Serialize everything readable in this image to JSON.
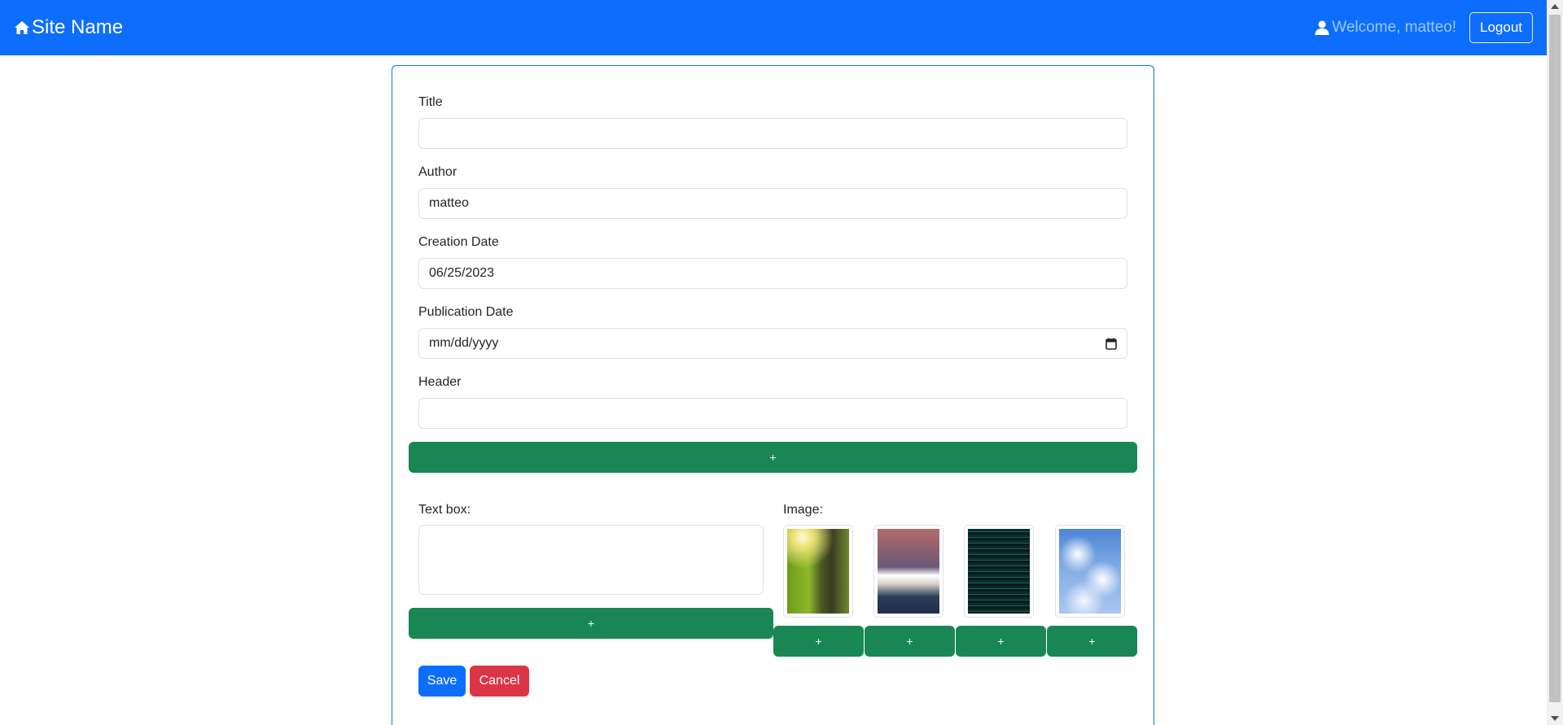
{
  "navbar": {
    "brand": "Site Name",
    "welcome": "Welcome, matteo!",
    "logout_label": "Logout",
    "color": "#0d6efd"
  },
  "form": {
    "title": {
      "label": "Title",
      "value": ""
    },
    "author": {
      "label": "Author",
      "value": "matteo"
    },
    "creation_date": {
      "label": "Creation Date",
      "value": "06/25/2023"
    },
    "publication_date": {
      "label": "Publication Date",
      "placeholder": "mm/dd/yyyy"
    },
    "header": {
      "label": "Header",
      "value": ""
    },
    "add_header_label": "+",
    "text_box": {
      "label": "Text box:",
      "value": "",
      "add_label": "+"
    },
    "image": {
      "label": "Image:",
      "thumbnails": [
        {
          "name": "forest",
          "add_label": "+"
        },
        {
          "name": "books",
          "add_label": "+"
        },
        {
          "name": "code",
          "add_label": "+"
        },
        {
          "name": "sky",
          "add_label": "+"
        }
      ]
    },
    "save_label": "Save",
    "cancel_label": "Cancel"
  },
  "colors": {
    "primary": "#0d6efd",
    "success": "#198754",
    "danger": "#dc3545"
  },
  "icons": {
    "brand": "home-icon",
    "user": "user-icon",
    "calendar": "calendar-icon"
  }
}
